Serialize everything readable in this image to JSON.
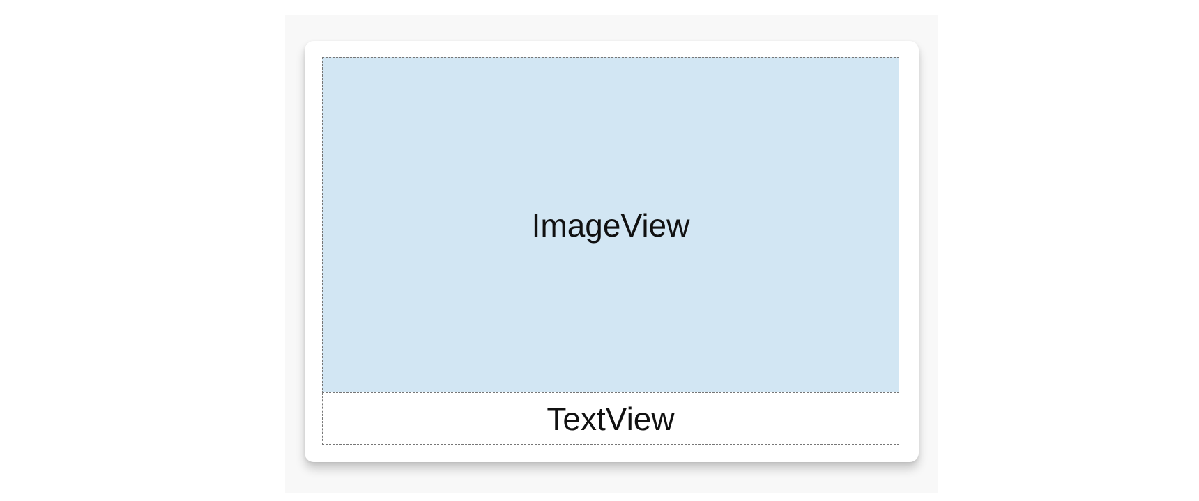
{
  "card": {
    "image_view": {
      "label": "ImageView",
      "background_color": "#d2e6f3"
    },
    "text_view": {
      "label": "TextView",
      "background_color": "#ffffff"
    }
  }
}
